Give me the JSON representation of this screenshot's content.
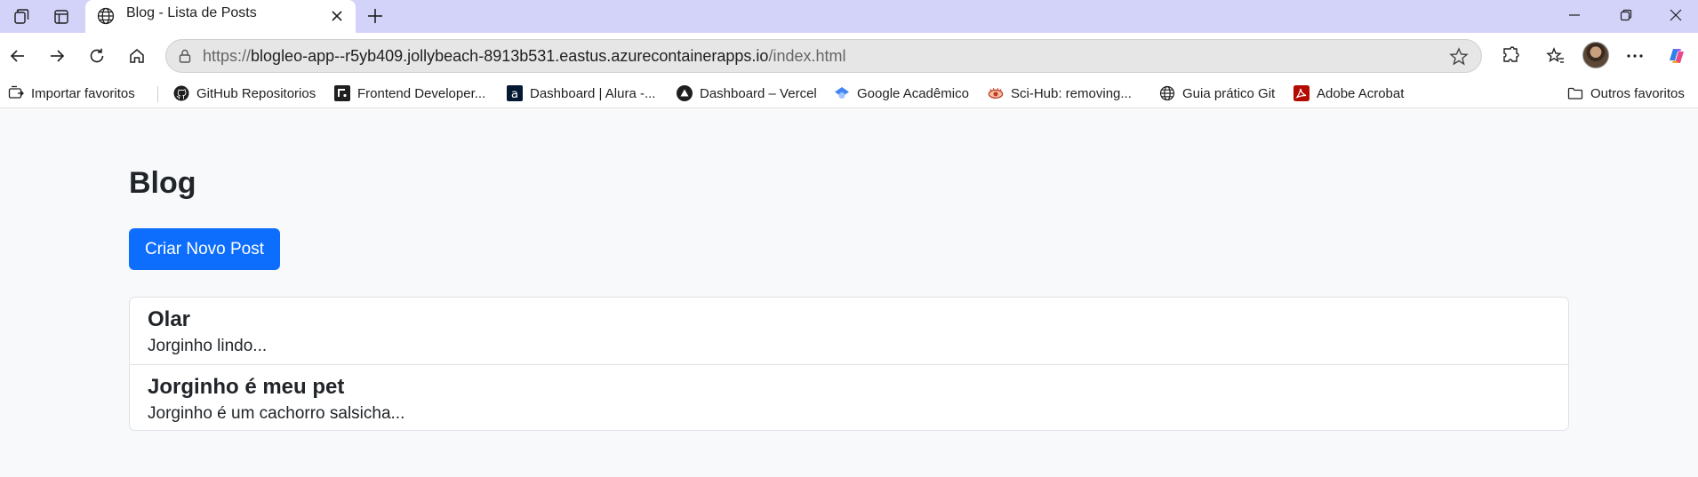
{
  "browser": {
    "tab": {
      "title": "Blog - Lista de Posts"
    },
    "address": {
      "protocol": "https://",
      "host": "blogleo-app--r5yb409.jollybeach-8913b531.eastus.azurecontainerapps.io",
      "path": "/index.html"
    },
    "bookmarks": [
      {
        "label": "Importar favoritos",
        "icon": "import-favorites-icon"
      },
      {
        "label": "GitHub Repositorios",
        "icon": "github-icon"
      },
      {
        "label": "Frontend Developer...",
        "icon": "frontend-mentor-icon"
      },
      {
        "label": "Dashboard | Alura -...",
        "icon": "alura-icon"
      },
      {
        "label": "Dashboard – Vercel",
        "icon": "vercel-icon"
      },
      {
        "label": "Google Acadêmico",
        "icon": "google-scholar-icon"
      },
      {
        "label": "Sci-Hub: removing...",
        "icon": "scihub-icon"
      },
      {
        "label": "Guia prático Git",
        "icon": "globe-icon"
      },
      {
        "label": "Adobe Acrobat",
        "icon": "adobe-acrobat-icon"
      }
    ],
    "other_favorites": {
      "label": "Outros favoritos",
      "icon": "folder-icon"
    }
  },
  "page": {
    "heading": "Blog",
    "new_post_button": "Criar Novo Post",
    "posts": [
      {
        "title": "Olar",
        "excerpt": "Jorginho lindo..."
      },
      {
        "title": "Jorginho é meu pet",
        "excerpt": "Jorginho é um cachorro salsicha..."
      }
    ]
  },
  "colors": {
    "titlebar": "#d3d3fa",
    "primary": "#0d6efd",
    "page_background": "#f8f9fa",
    "text": "#212529",
    "border": "#dee2e6"
  }
}
